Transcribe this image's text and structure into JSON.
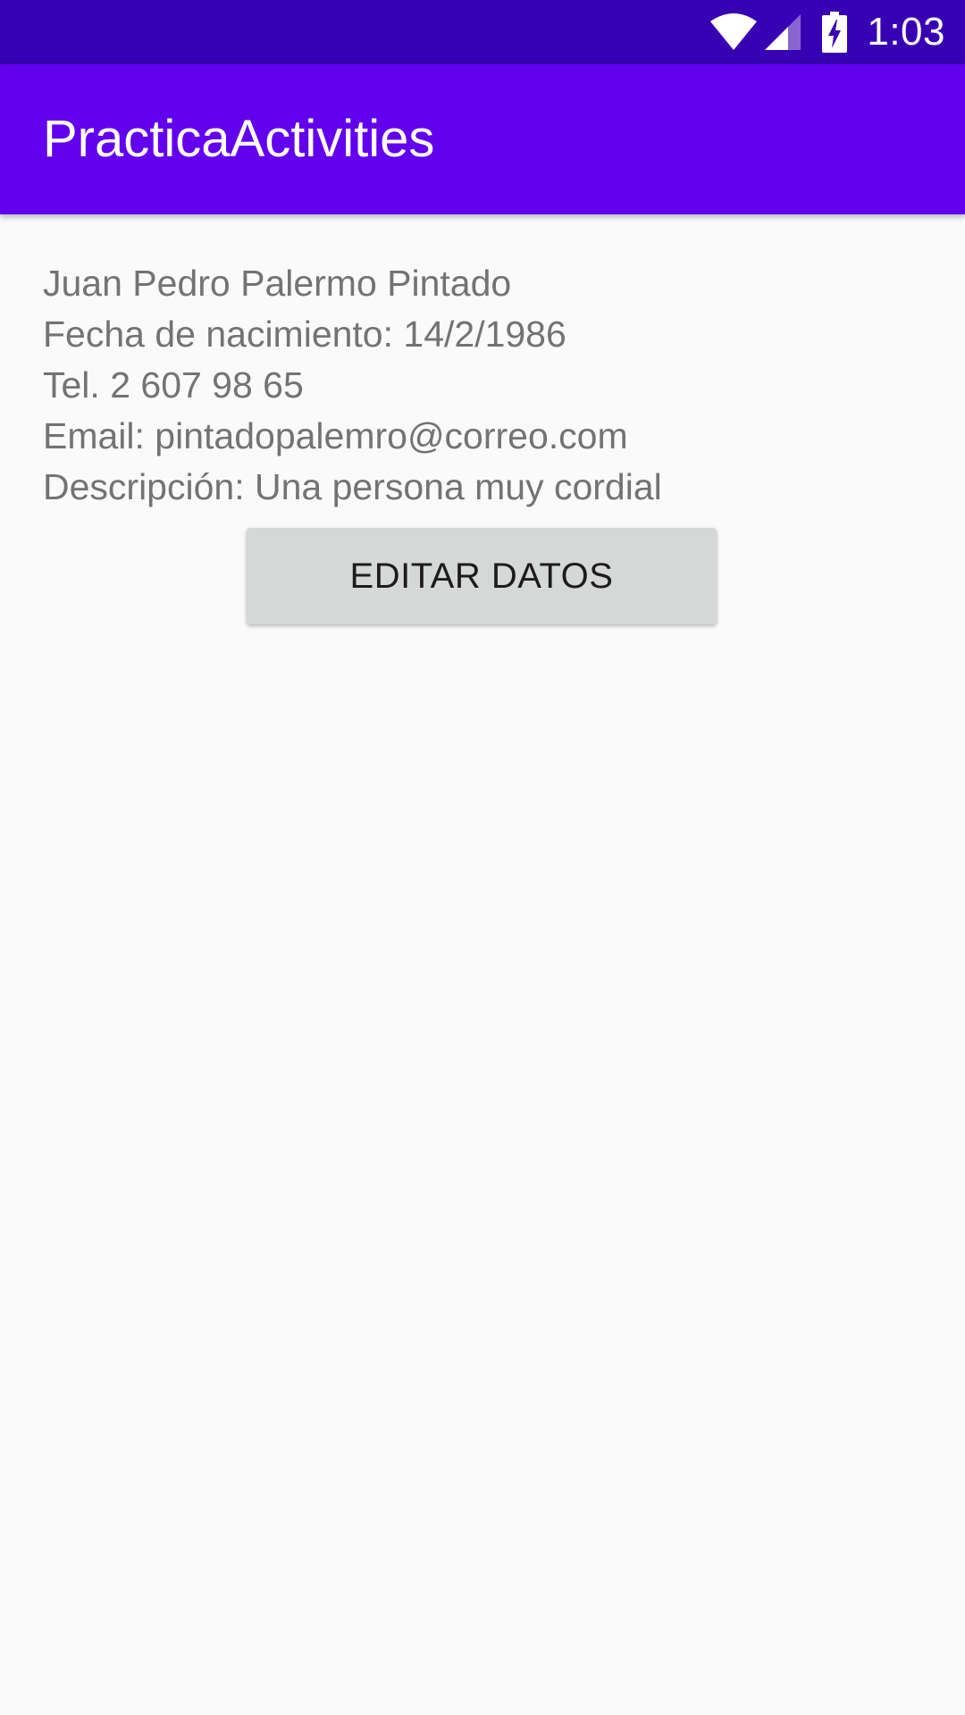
{
  "status_bar": {
    "time": "1:03",
    "icons": [
      "wifi-icon",
      "signal-icon",
      "battery-charging-icon"
    ],
    "color": "#3700b3"
  },
  "app_bar": {
    "title": "PracticaActivities",
    "color": "#6200ee"
  },
  "profile": {
    "name": "Juan Pedro Palermo Pintado",
    "birth_date": "Fecha de nacimiento: 14/2/1986",
    "phone": "Tel. 2 607 98 65",
    "email": "Email: pintadopalemro@correo.com",
    "description": "Descripción: Una persona muy cordial"
  },
  "actions": {
    "edit_label": "EDITAR DATOS"
  }
}
